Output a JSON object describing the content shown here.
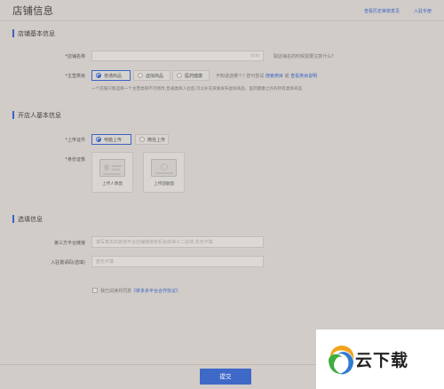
{
  "header": {
    "title": "店铺信息",
    "link_history": "查看历史审核意见",
    "link_manual": "入驻手册"
  },
  "section_basic": {
    "title": "店铺基本信息",
    "shop_name_label": "*店铺名称",
    "shop_name_value": "",
    "shop_name_counter": "0/30",
    "shop_name_tip": "取店铺名的时候需要注意什么?",
    "category_label": "*主营类目",
    "category_options": [
      "普通商品",
      "虚拟商品",
      "医药健康"
    ],
    "category_selected": "普通商品",
    "category_hint_prefix": "不知道选哪个? 您可尝试",
    "category_search_link": "搜索类目",
    "category_or": "或",
    "category_desc_link": "查看类目说明",
    "category_note": "一个店铺只能选择一个主营类目不可修改,普通类目入驻后,可以补充资质发布虚拟商品、医药健康之外的所有类目商品"
  },
  "section_owner": {
    "title": "开店人基本信息",
    "upload_method_label": "*上传证件",
    "upload_methods": [
      "电脑上传",
      "微信上传"
    ],
    "upload_method_selected": "电脑上传",
    "id_label": "*身份证像",
    "id_front_caption": "上传人像面",
    "id_back_caption": "上传国徽面"
  },
  "section_optional": {
    "title": "选填信息",
    "third_party_label": "第三方平台链接",
    "third_party_placeholder": "填写真实的其他平台店铺链接有机会获得小二扶持,非无不填",
    "invite_label": "入驻邀请码(选填)",
    "invite_placeholder": "若无不填",
    "agree_text": "我已阅读并同意",
    "agree_link": "《拼多多平台合作协议》"
  },
  "footer": {
    "submit_label": "提交"
  },
  "watermark": {
    "text": "云下载"
  },
  "colors": {
    "accent": "#3a63c4",
    "background": "#d1ccc8"
  }
}
